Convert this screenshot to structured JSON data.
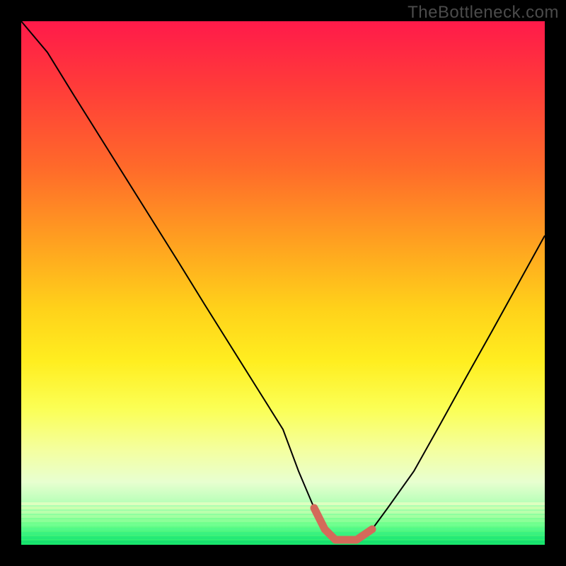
{
  "watermark": "TheBottleneck.com",
  "chart_data": {
    "type": "line",
    "title": "",
    "xlabel": "",
    "ylabel": "",
    "xlim": [
      0,
      100
    ],
    "ylim": [
      0,
      100
    ],
    "series": [
      {
        "name": "bottleneck-curve",
        "x": [
          0,
          5,
          10,
          15,
          20,
          25,
          30,
          35,
          40,
          45,
          50,
          53,
          56,
          58,
          60,
          62,
          64,
          67,
          70,
          75,
          80,
          85,
          90,
          95,
          100
        ],
        "values": [
          100,
          94,
          86,
          78,
          70,
          62,
          54,
          46,
          38,
          30,
          22,
          14,
          7,
          3,
          1,
          1,
          1,
          3,
          7,
          14,
          23,
          32,
          41,
          50,
          59
        ]
      },
      {
        "name": "highlight-segment",
        "x": [
          56,
          58,
          60,
          62,
          64,
          67
        ],
        "values": [
          7,
          3,
          1,
          1,
          1,
          3
        ]
      }
    ],
    "colors": {
      "curve": "#000000",
      "highlight": "#d46a5a",
      "gradient_top": "#ff1a4a",
      "gradient_bottom": "#17e86b"
    }
  }
}
